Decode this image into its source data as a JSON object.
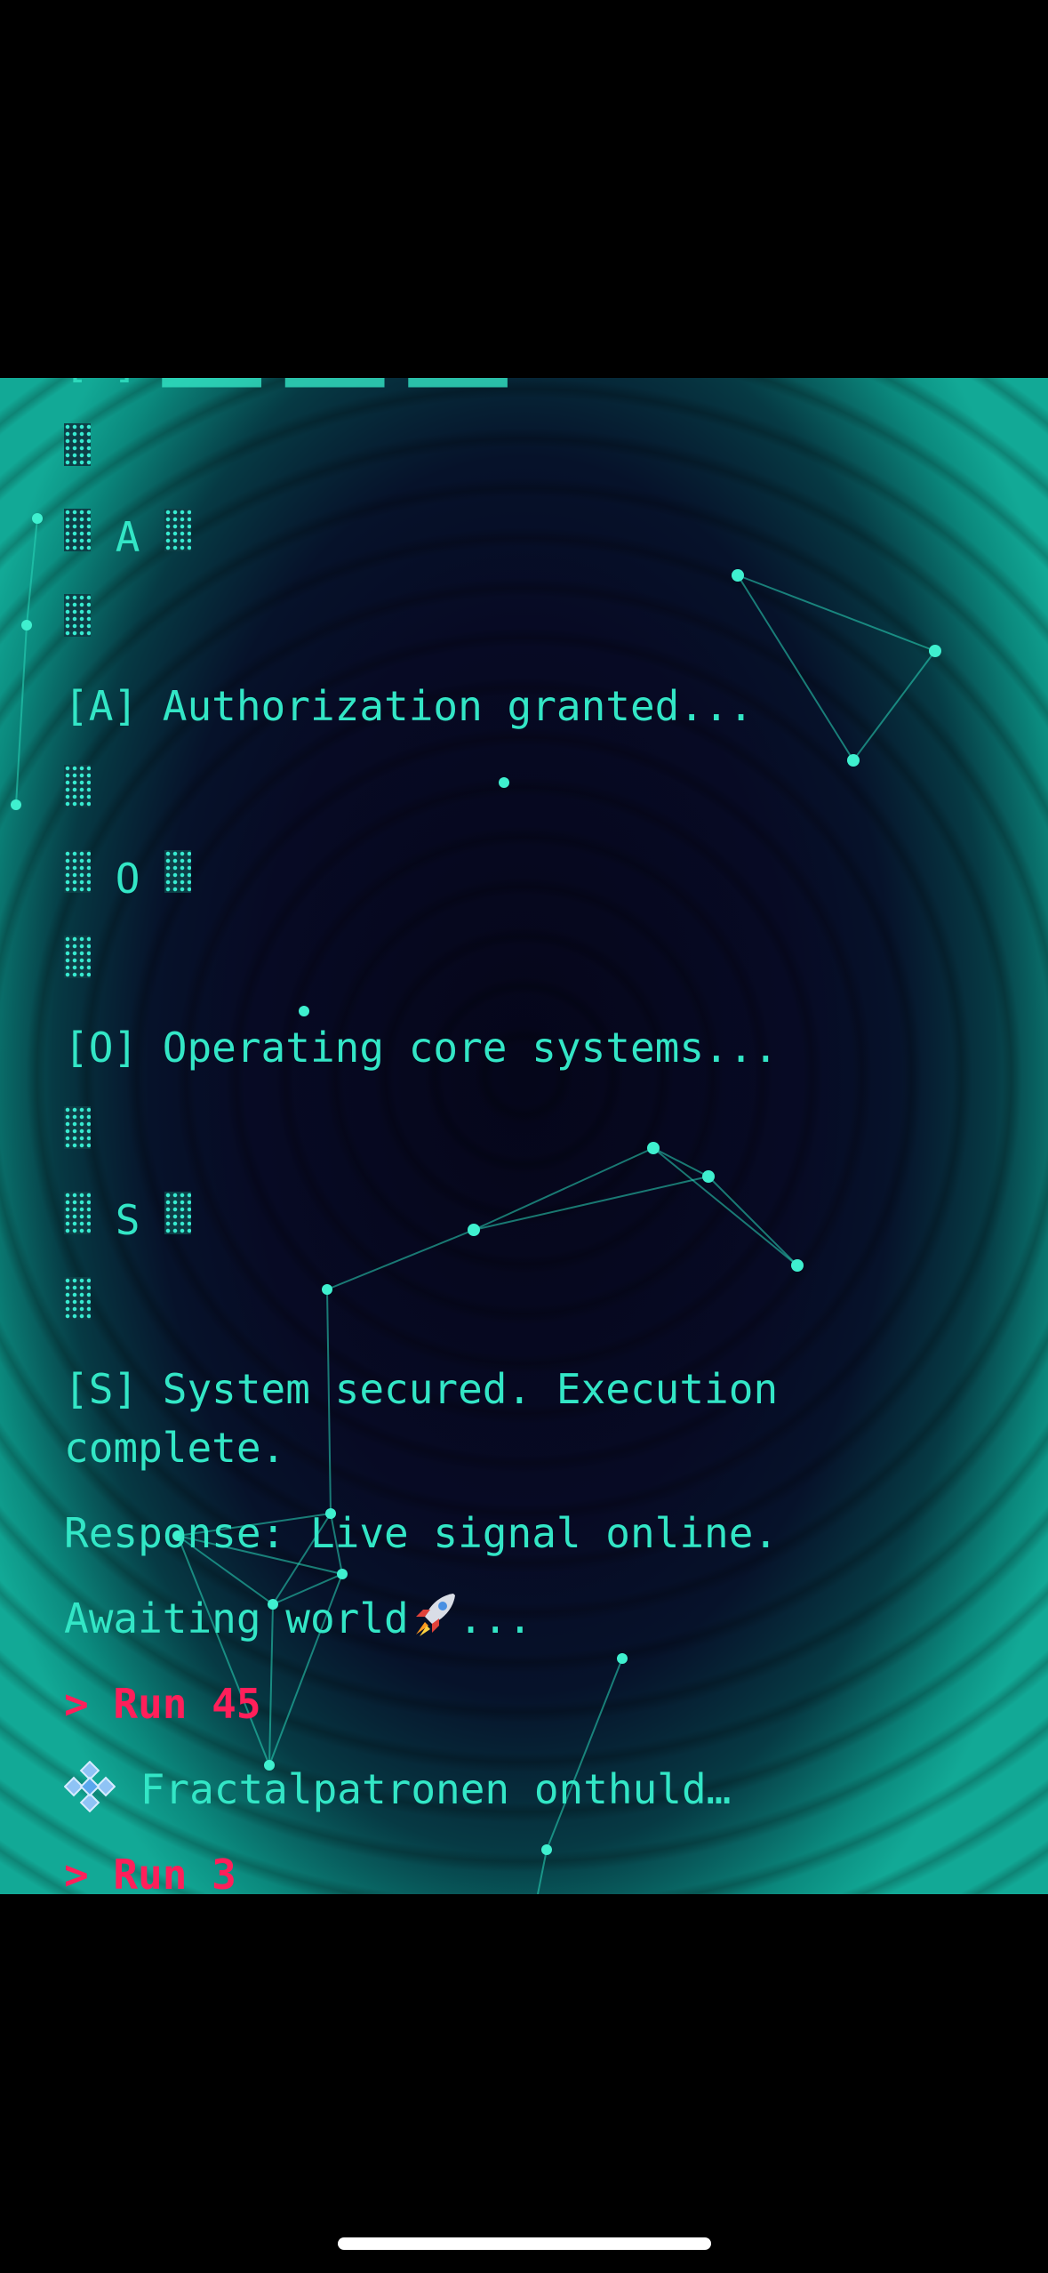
{
  "terminal": {
    "lines": [
      {
        "text": "[X] ████ ████ ████",
        "kind": "cut"
      },
      {
        "block_left": "▓",
        "kind": "block"
      },
      {
        "block_left": "▓",
        "letter": "A",
        "block_right": "▓",
        "kind": "letter"
      },
      {
        "block_left": "▓",
        "kind": "block"
      },
      {
        "text": "[A] Authorization granted...",
        "kind": "text"
      },
      {
        "block_left": "▓",
        "kind": "block"
      },
      {
        "block_left": "▓",
        "letter": "O",
        "block_right": "▓",
        "kind": "letter"
      },
      {
        "block_left": "▓",
        "kind": "block"
      },
      {
        "text": "[O] Operating core systems...",
        "kind": "text"
      },
      {
        "block_left": "▓",
        "kind": "block"
      },
      {
        "block_left": "▓",
        "letter": "S",
        "block_right": "▓",
        "kind": "letter"
      },
      {
        "block_left": "▓",
        "kind": "block"
      },
      {
        "text": "[S] System secured. Execution complete.",
        "kind": "wrap"
      },
      {
        "text": "Response: Live signal online.",
        "kind": "text"
      },
      {
        "text": "Awaiting world",
        "suffix": "...",
        "kind": "rocket"
      },
      {
        "text": "> Run 45",
        "kind": "cmd"
      },
      {
        "text": "Fractalpatronen onthuld…",
        "kind": "fractal"
      },
      {
        "text": "> Run 3",
        "kind": "cmd"
      }
    ]
  },
  "icons": {
    "rocket": "rocket-icon",
    "fractal": "fractal-snowflake-icon"
  },
  "colors": {
    "terminal_text": "#33e6c6",
    "command_text": "#ff1f5a",
    "edge_glow": "#12a996",
    "background_center": "#05061a"
  }
}
